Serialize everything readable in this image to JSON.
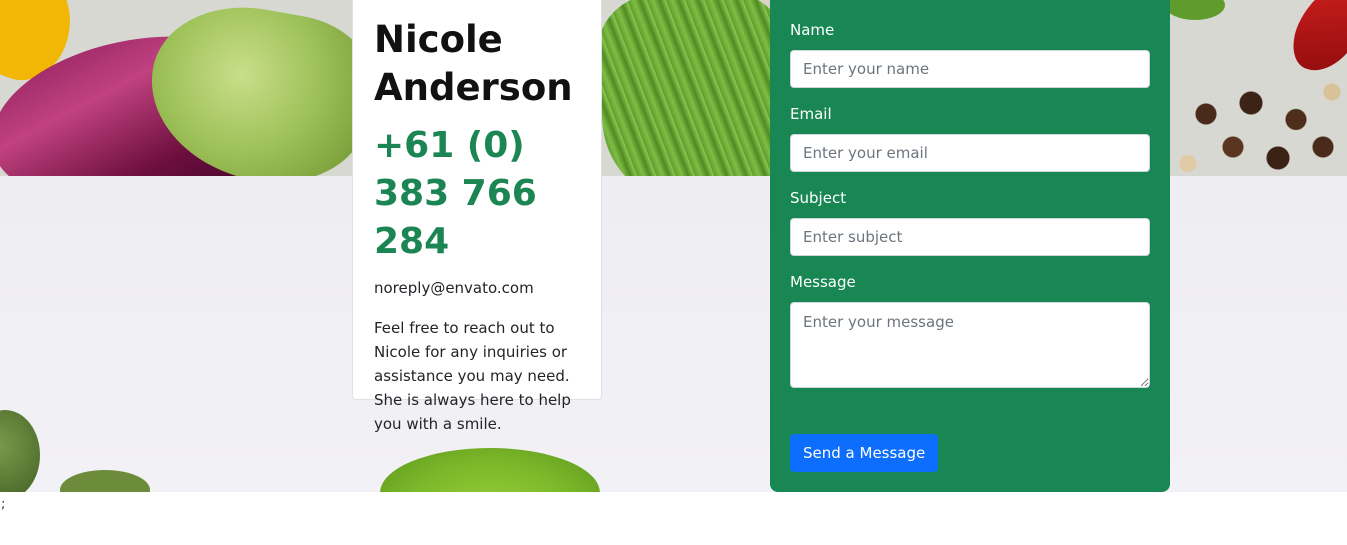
{
  "contact": {
    "name": "Nicole Anderson",
    "phone": "+61 (0) 383 766 284",
    "email": "noreply@envato.com",
    "description": "Feel free to reach out to Nicole for any inquiries or assistance you may need. She is always here to help you with a smile."
  },
  "form": {
    "name_label": "Name",
    "name_placeholder": "Enter your name",
    "email_label": "Email",
    "email_placeholder": "Enter your email",
    "subject_label": "Subject",
    "subject_placeholder": "Enter subject",
    "message_label": "Message",
    "message_placeholder": "Enter your message",
    "submit_label": "Send a Message"
  },
  "stray_text": ";",
  "colors": {
    "form_background": "#198754",
    "phone_text": "#1b8553",
    "button": "#0d6efd"
  }
}
